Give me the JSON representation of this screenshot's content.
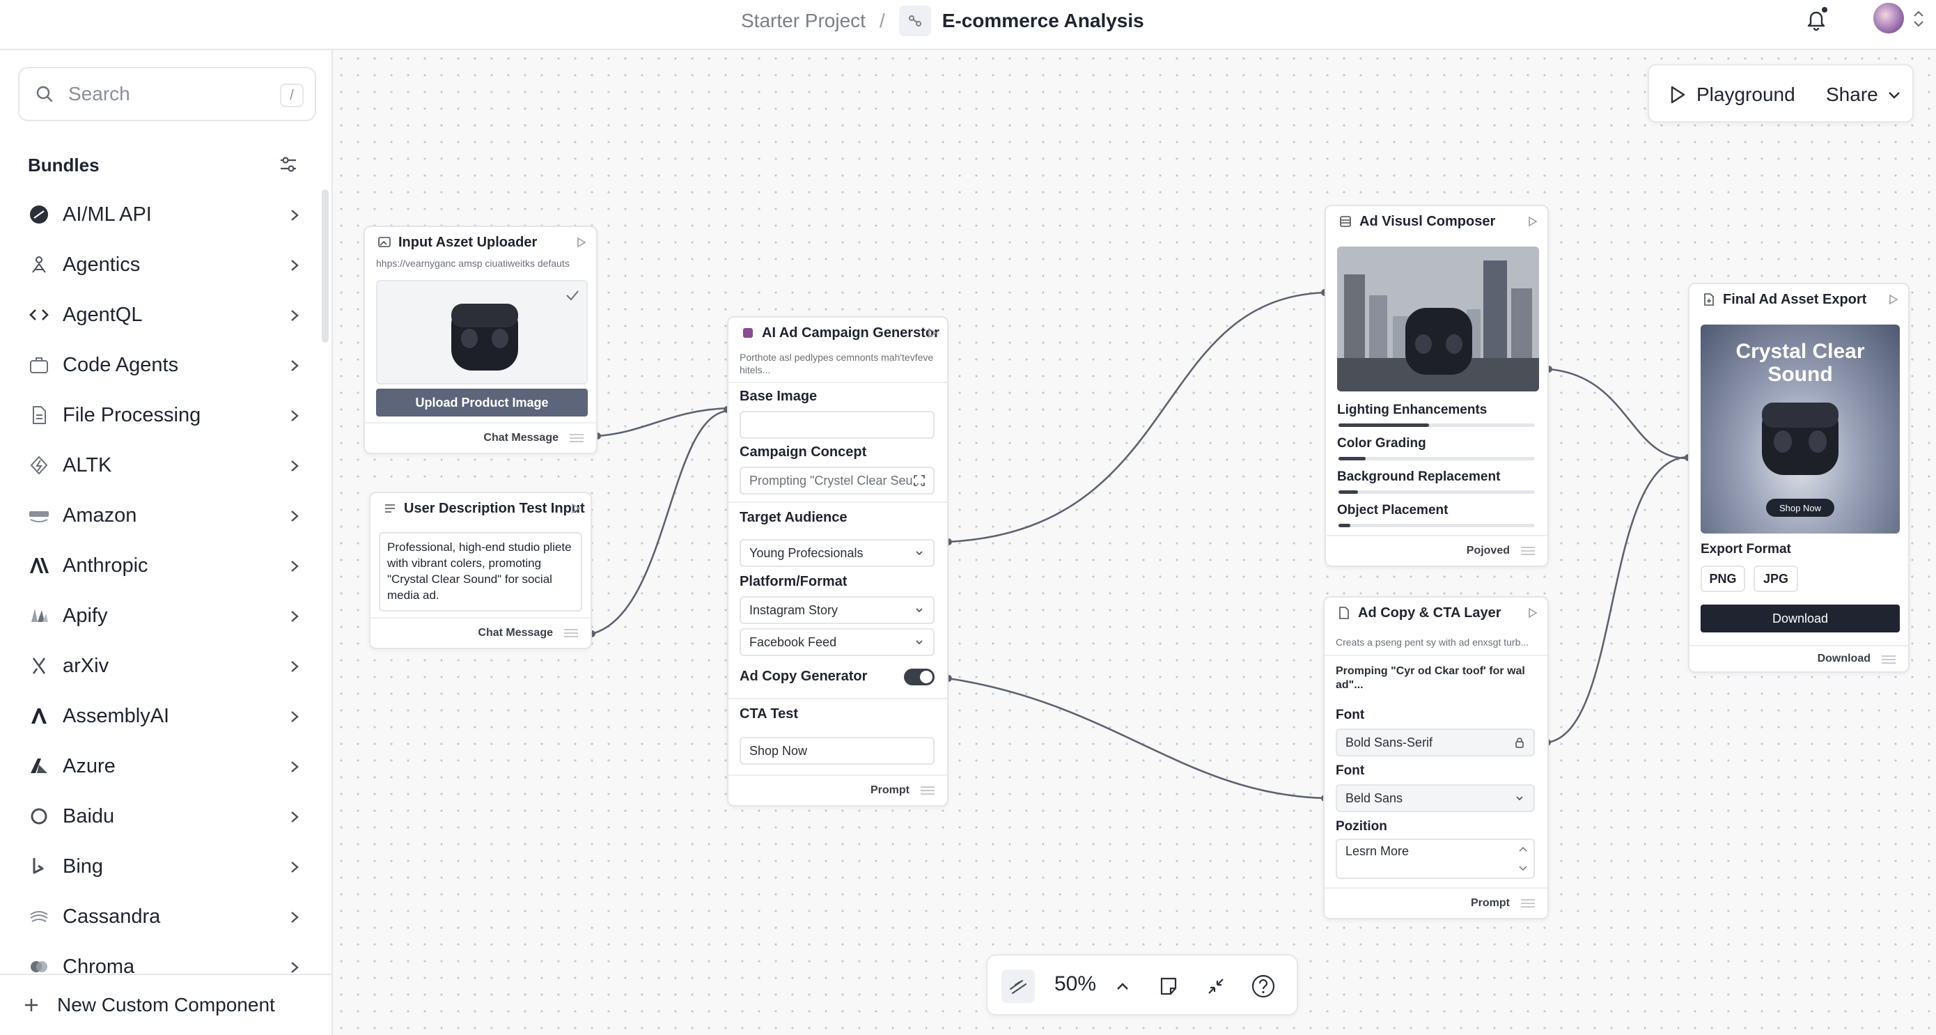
{
  "header": {
    "project": "Starter Project",
    "separator": "/",
    "flow_name": "E-commerce Analysis"
  },
  "sidebar": {
    "search_placeholder": "Search",
    "search_shortcut": "/",
    "section_title": "Bundles",
    "items": [
      {
        "label": "AI/ML API",
        "icon": "aiml-icon"
      },
      {
        "label": "Agentics",
        "icon": "agentics-icon"
      },
      {
        "label": "AgentQL",
        "icon": "code-brackets-icon"
      },
      {
        "label": "Code Agents",
        "icon": "briefcase-icon"
      },
      {
        "label": "File Processing",
        "icon": "file-icon"
      },
      {
        "label": "ALTK",
        "icon": "altk-icon"
      },
      {
        "label": "Amazon",
        "icon": "amazon-icon"
      },
      {
        "label": "Anthropic",
        "icon": "anthropic-icon"
      },
      {
        "label": "Apify",
        "icon": "apify-icon"
      },
      {
        "label": "arXiv",
        "icon": "arxiv-icon"
      },
      {
        "label": "AssemblyAI",
        "icon": "assemblyai-icon"
      },
      {
        "label": "Azure",
        "icon": "azure-icon"
      },
      {
        "label": "Baidu",
        "icon": "baidu-icon"
      },
      {
        "label": "Bing",
        "icon": "bing-icon"
      },
      {
        "label": "Cassandra",
        "icon": "cassandra-icon"
      },
      {
        "label": "Chroma",
        "icon": "chroma-icon"
      }
    ],
    "new_component": "New Custom Component"
  },
  "actions": {
    "playground": "Playground",
    "share": "Share"
  },
  "toolbar": {
    "zoom": "50%"
  },
  "nodes": {
    "uploader": {
      "title": "Input Aszet Uploader",
      "desc": "hhps://vearnyganc amsp ciuatiweitks defauts",
      "button": "Upload Product Image",
      "footer": "Chat Message"
    },
    "user_desc": {
      "title": "User Description Test Input",
      "text": "Professional, high-end studio pliete with vibrant colers, promoting \"Crystal Clear Sound\" for social media ad.",
      "footer": "Chat Message"
    },
    "campaign": {
      "title": "AI Ad Campaign Generstor",
      "desc": "Porthote asl pedlypes cemnonts mah'tevfeve hitels...",
      "base_image_label": "Base Image",
      "concept_label": "Campaign Concept",
      "concept_value": "Prompting \"Crystel Clear Seu...",
      "audience_label": "Target Audience",
      "audience_value": "Young Profecsionals",
      "platform_label": "Platform/Format",
      "platform_value_1": "Instagram Story",
      "platform_value_2": "Facebook Feed",
      "adcopy_label": "Ad Copy Generator",
      "adcopy_on": true,
      "cta_label": "CTA Test",
      "cta_value": "Shop Now",
      "footer": "Prompt"
    },
    "visual": {
      "title": "Ad Visusl Composer",
      "lighting": "Lighting Enhancements",
      "lighting_level": 0.46,
      "color": "Color Grading",
      "color_level": 0.14,
      "background": "Background Replacement",
      "background_level": 0.1,
      "object": "Object Placement",
      "object_level": 0.06,
      "footer": "Pojoved"
    },
    "copy": {
      "title": "Ad Copy & CTA Layer",
      "desc": "Creats a pseng pent sy with ad enxsgt turb...",
      "prompt_text": "Promping \"Cyr od Ckar toof' for wal ad\"...",
      "font_label_1": "Font",
      "font_value_1": "Bold Sans-Serif",
      "font_label_2": "Font",
      "font_value_2": "Beld Sans",
      "position_label": "Pozition",
      "position_value": "Lesrn More",
      "footer": "Prompt"
    },
    "export": {
      "title": "Final Ad Asset Export",
      "image_title": "Crystal Clear Sound",
      "image_button": "Shop Now",
      "format_label": "Export Format",
      "format_png": "PNG",
      "format_jpg": "JPG",
      "download_button": "Download",
      "footer": "Download"
    }
  }
}
